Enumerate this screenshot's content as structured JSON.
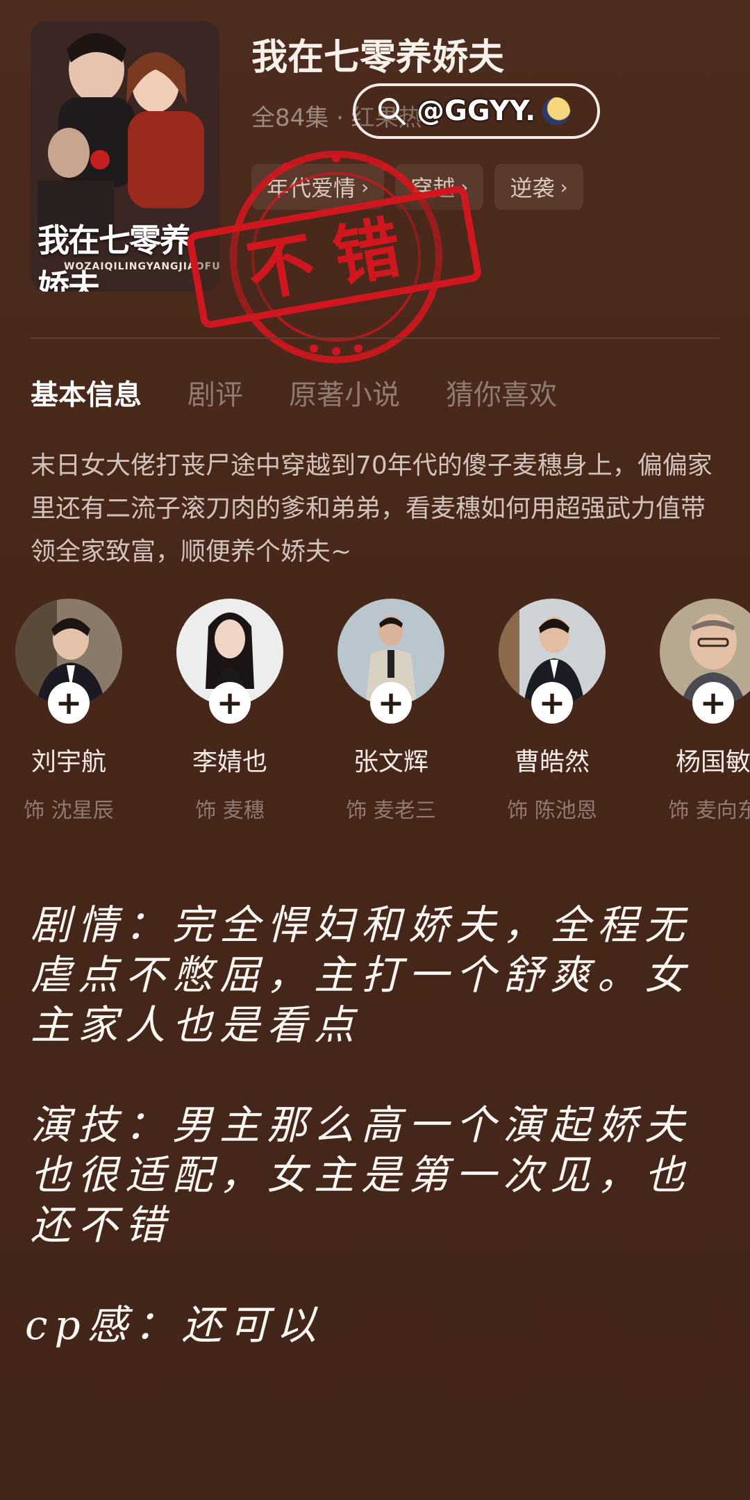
{
  "drama": {
    "title": "我在七零养娇夫",
    "meta": "全84集 · 红果热",
    "cover_title": "我在七零养娇夫",
    "cover_pinyin": "WOZAIQILINGYANGJIAOFU"
  },
  "watermark": {
    "icon": "search-icon",
    "handle": "@GGYY."
  },
  "tags": [
    {
      "label": "年代爱情"
    },
    {
      "label": "穿越"
    },
    {
      "label": "逆袭"
    }
  ],
  "stamp_text": "不错",
  "tabs": [
    {
      "label": "基本信息",
      "active": true
    },
    {
      "label": "剧评",
      "active": false
    },
    {
      "label": "原著小说",
      "active": false
    },
    {
      "label": "猜你喜欢",
      "active": false
    }
  ],
  "synopsis": "末日女大佬打丧尸途中穿越到70年代的傻子麦穗身上，偏偏家里还有二流子滚刀肉的爹和弟弟，看麦穗如何用超强武力值带领全家致富，顺便养个娇夫~",
  "cast": [
    {
      "name": "刘宇航",
      "role": "饰 沈星辰"
    },
    {
      "name": "李婧也",
      "role": "饰 麦穗"
    },
    {
      "name": "张文辉",
      "role": "饰 麦老三"
    },
    {
      "name": "曹皓然",
      "role": "饰 陈池恩"
    },
    {
      "name": "杨国敏",
      "role": "饰 麦向东"
    }
  ],
  "review": {
    "plot": "剧情：完全悍妇和娇夫，全程无虐点不憋屈，主打一个舒爽。女主家人也是看点",
    "acting": "演技：男主那么高一个演起娇夫也很适配，女主是第一次见，也还不错",
    "cp": "cp感：还可以"
  },
  "colors": {
    "background": "#4a2a1c",
    "stamp_red": "#d0161e",
    "tag_bg": "#5a3a2c"
  }
}
